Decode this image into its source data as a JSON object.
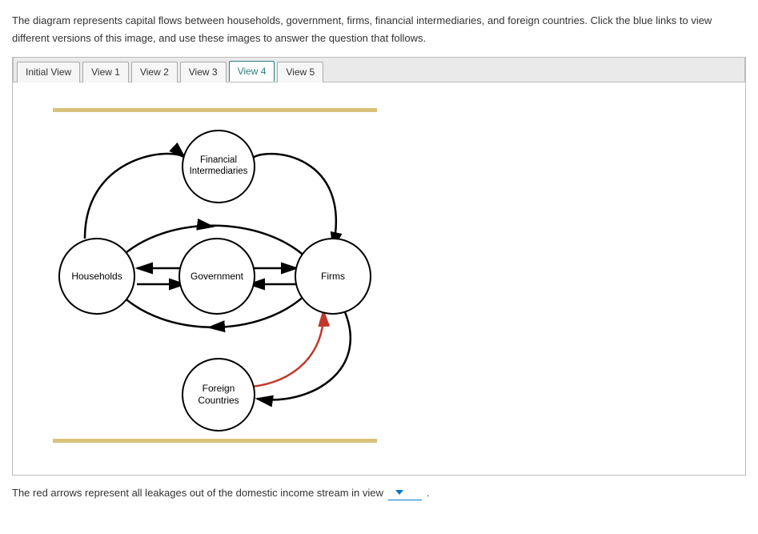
{
  "intro": "The diagram represents capital flows between households, government, firms, financial intermediaries, and foreign countries. Click the blue links to view different versions of this image, and use these images to answer the question that follows.",
  "tabs": [
    {
      "label": "Initial View",
      "active": false
    },
    {
      "label": "View 1",
      "active": false
    },
    {
      "label": "View 2",
      "active": false
    },
    {
      "label": "View 3",
      "active": false
    },
    {
      "label": "View 4",
      "active": true
    },
    {
      "label": "View 5",
      "active": false
    }
  ],
  "diagram": {
    "nodes": {
      "households": "Households",
      "government": "Government",
      "firms": "Firms",
      "financial_intermediaries": "Financial\nIntermediaries",
      "foreign_countries": "Foreign\nCountries"
    }
  },
  "answer_text": "The red arrows represent all leakages out of the domestic income stream in view",
  "answer_suffix": "."
}
